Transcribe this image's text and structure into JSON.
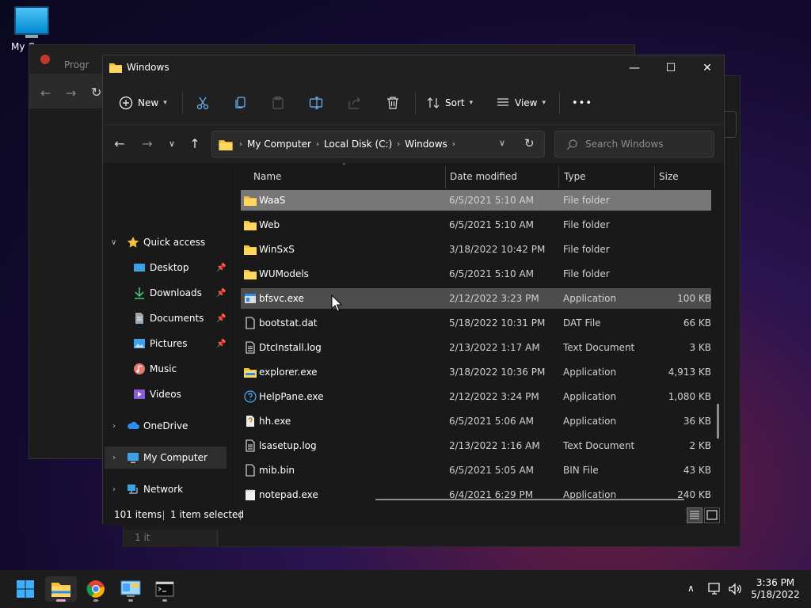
{
  "desktop": {
    "icon_label": "My Co"
  },
  "bg_windows": {
    "tab_label": "Progr",
    "status_label": "1 it"
  },
  "window": {
    "title": "Windows",
    "controls": {
      "minimize": "—",
      "maximize": "☐",
      "close": "✕"
    }
  },
  "toolbar": {
    "new_label": "New",
    "sort_label": "Sort",
    "view_label": "View",
    "more_label": "•••"
  },
  "address": {
    "crumbs": [
      "My Computer",
      "Local Disk (C:)",
      "Windows"
    ]
  },
  "search": {
    "placeholder": "Search Windows"
  },
  "nav": {
    "quick_access": "Quick access",
    "desktop": "Desktop",
    "downloads": "Downloads",
    "documents": "Documents",
    "pictures": "Pictures",
    "music": "Music",
    "videos": "Videos",
    "onedrive": "OneDrive",
    "my_computer": "My Computer",
    "network": "Network"
  },
  "columns": {
    "name": "Name",
    "date": "Date modified",
    "type": "Type",
    "size": "Size"
  },
  "files": [
    {
      "name": "WaaS",
      "date": "6/5/2021 5:10 AM",
      "type": "File folder",
      "size": ""
    },
    {
      "name": "Web",
      "date": "6/5/2021 5:10 AM",
      "type": "File folder",
      "size": ""
    },
    {
      "name": "WinSxS",
      "date": "3/18/2022 10:42 PM",
      "type": "File folder",
      "size": ""
    },
    {
      "name": "WUModels",
      "date": "6/5/2021 5:10 AM",
      "type": "File folder",
      "size": ""
    },
    {
      "name": "bfsvc.exe",
      "date": "2/12/2022 3:23 PM",
      "type": "Application",
      "size": "100 KB"
    },
    {
      "name": "bootstat.dat",
      "date": "5/18/2022 10:31 PM",
      "type": "DAT File",
      "size": "66 KB"
    },
    {
      "name": "DtcInstall.log",
      "date": "2/13/2022 1:17 AM",
      "type": "Text Document",
      "size": "3 KB"
    },
    {
      "name": "explorer.exe",
      "date": "3/18/2022 10:36 PM",
      "type": "Application",
      "size": "4,913 KB"
    },
    {
      "name": "HelpPane.exe",
      "date": "2/12/2022 3:24 PM",
      "type": "Application",
      "size": "1,080 KB"
    },
    {
      "name": "hh.exe",
      "date": "6/5/2021 5:06 AM",
      "type": "Application",
      "size": "36 KB"
    },
    {
      "name": "lsasetup.log",
      "date": "2/13/2022 1:16 AM",
      "type": "Text Document",
      "size": "2 KB"
    },
    {
      "name": "mib.bin",
      "date": "6/5/2021 5:05 AM",
      "type": "BIN File",
      "size": "43 KB"
    },
    {
      "name": "notepad.exe",
      "date": "6/4/2021 6:29 PM",
      "type": "Application",
      "size": "240 KB"
    }
  ],
  "status": {
    "items": "101 items",
    "selected": "1 item selected"
  },
  "taskbar": {
    "time": "3:36 PM",
    "date": "5/18/2022"
  },
  "colors": {
    "accent": "#0078d4",
    "folder": "#f3c23c",
    "selected_row": "#777777",
    "hover_row": "#4d4d4d"
  }
}
